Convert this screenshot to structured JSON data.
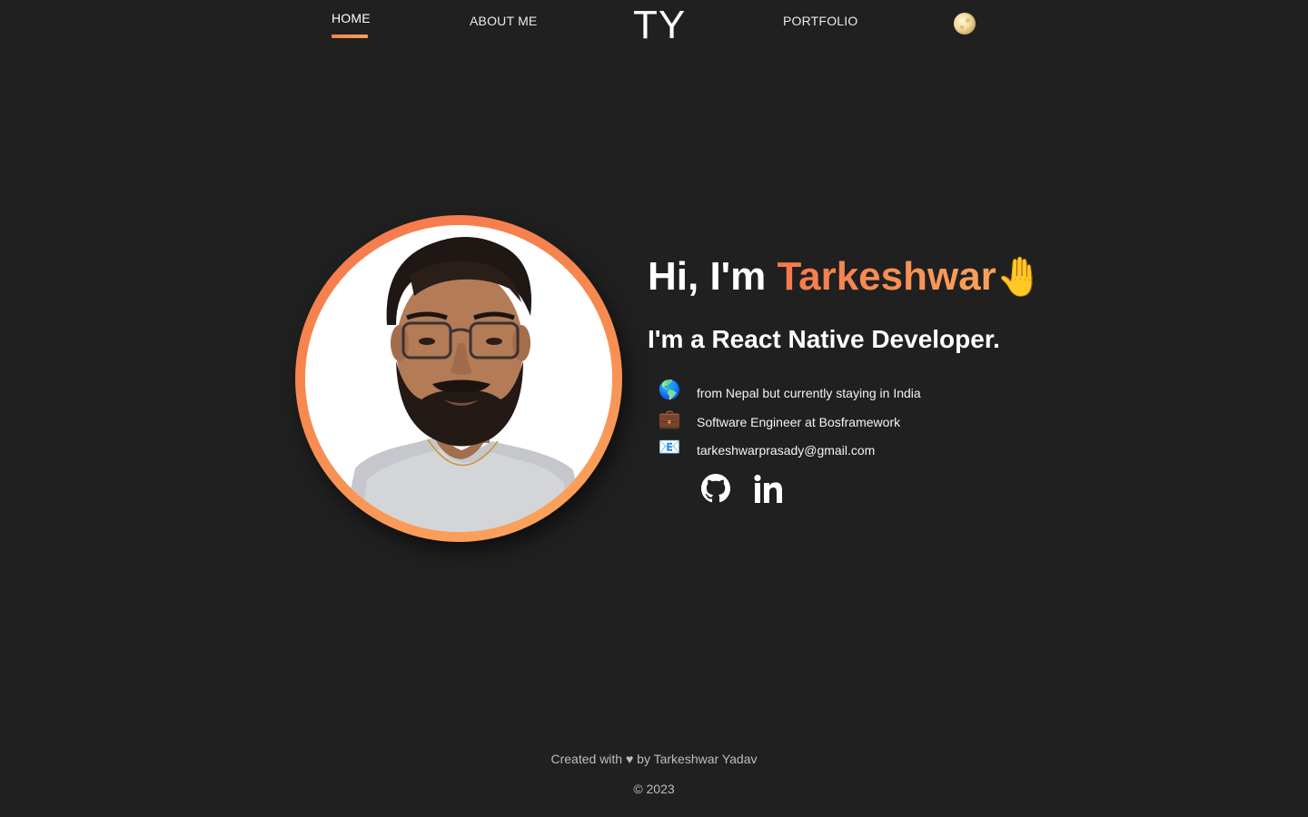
{
  "nav": {
    "home": "HOME",
    "about": "ABOUT ME",
    "logo": "TY",
    "portfolio": "PORTFOLIO",
    "active": "HOME",
    "theme_icon": "moon-icon"
  },
  "hero": {
    "greeting_prefix": "Hi, I'm ",
    "name": "Tarkeshwar",
    "wave": "🤚",
    "role": "I'm a React Native Developer.",
    "info": [
      {
        "icon": "🌎",
        "icon_name": "globe-icon",
        "text": "from Nepal but currently staying in India"
      },
      {
        "icon": "💼",
        "icon_name": "briefcase-icon",
        "text": "Software Engineer at Bosframework"
      },
      {
        "icon": "📧",
        "icon_name": "email-icon",
        "text": "tarkeshwarprasady@gmail.com"
      }
    ],
    "social": [
      {
        "name": "github-icon"
      },
      {
        "name": "linkedin-icon"
      }
    ]
  },
  "footer": {
    "created": "Created with ♥ by Tarkeshwar Yadav",
    "copyright": "© 2023"
  },
  "colors": {
    "background": "#202020",
    "accent_start": "#f5774c",
    "accent_end": "#f9a35c",
    "text": "#ffffff",
    "footer_text": "#bdbdbd"
  }
}
